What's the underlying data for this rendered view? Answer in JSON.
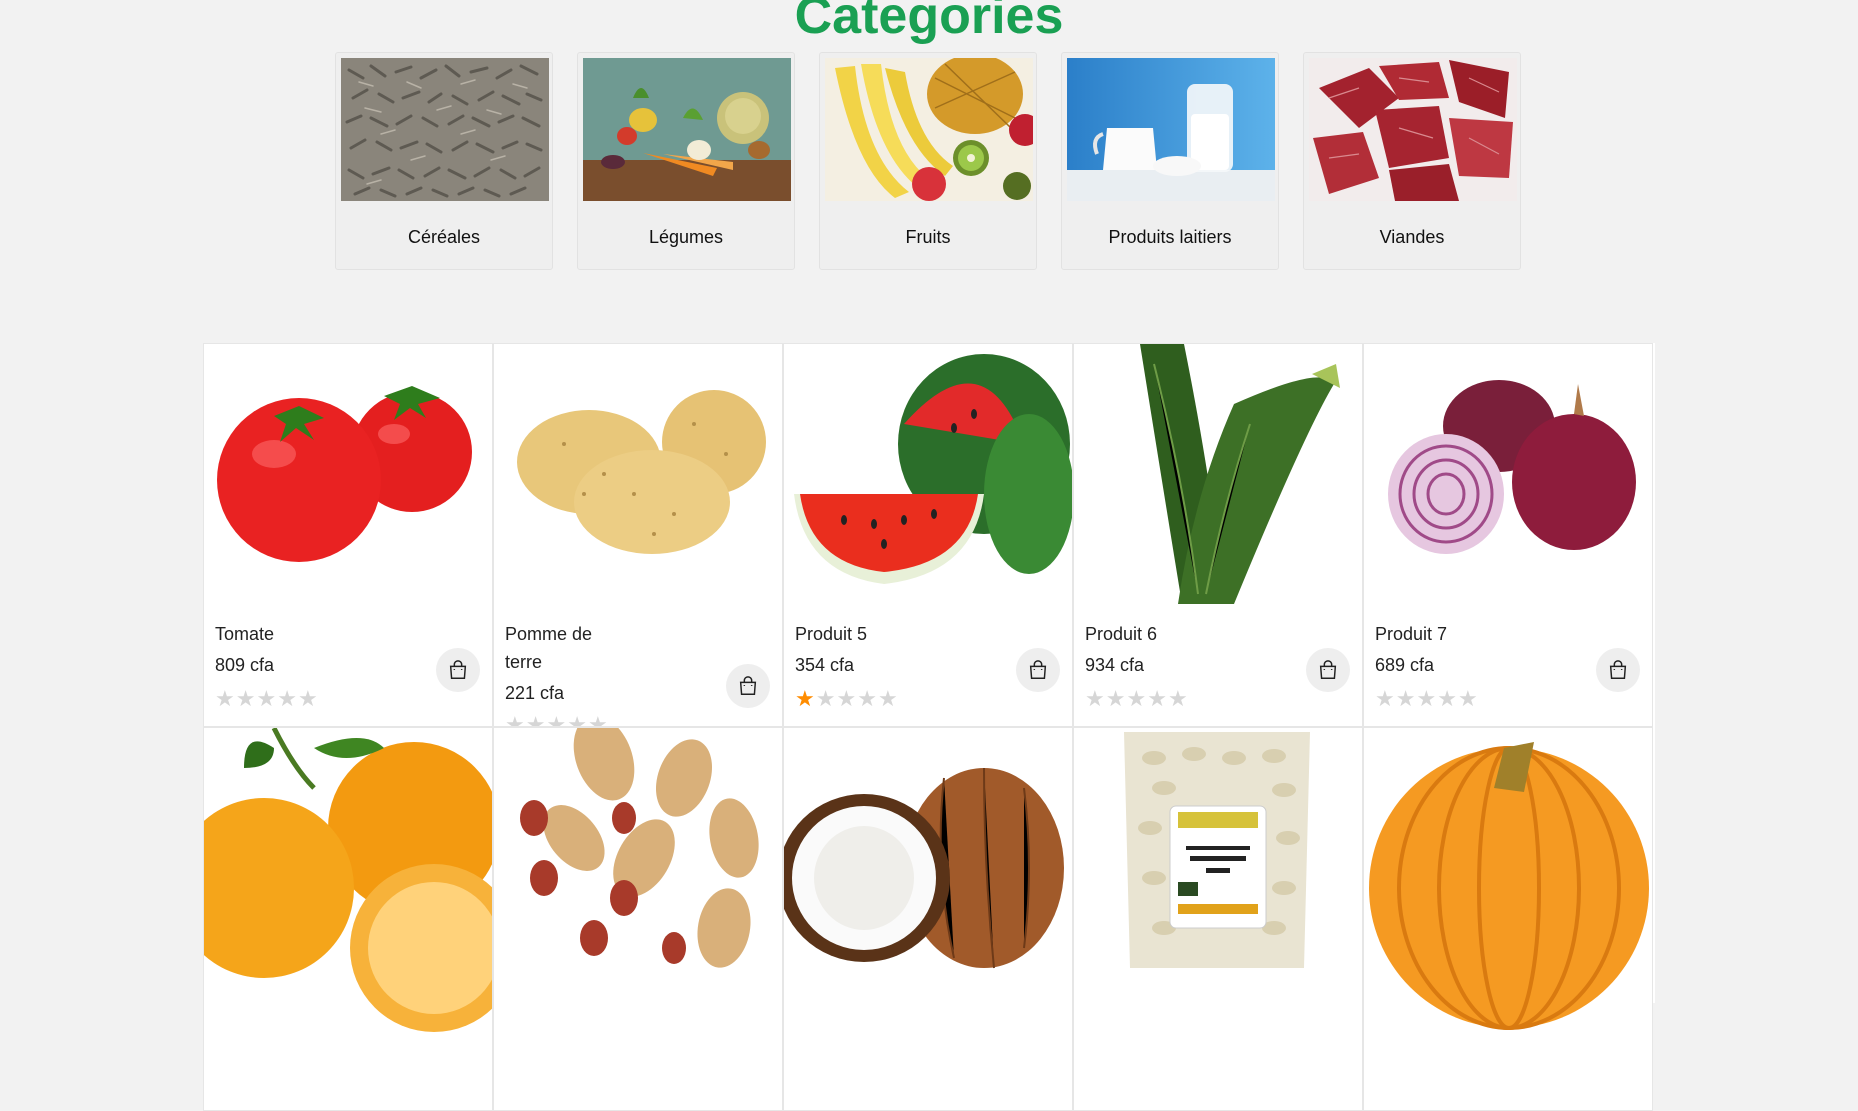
{
  "categories_section": {
    "title": "Categories",
    "items": [
      {
        "label": "Céréales"
      },
      {
        "label": "Légumes"
      },
      {
        "label": "Fruits"
      },
      {
        "label": "Produits laitiers"
      },
      {
        "label": "Viandes"
      }
    ]
  },
  "products": [
    {
      "name": "Tomate",
      "price": "809 cfa",
      "rating": 0
    },
    {
      "name": "Pomme de terre",
      "price": "221 cfa",
      "rating": 0
    },
    {
      "name": "Produit 5",
      "price": "354 cfa",
      "rating": 1
    },
    {
      "name": "Produit 6",
      "price": "934 cfa",
      "rating": 0
    },
    {
      "name": "Produit 7",
      "price": "689 cfa",
      "rating": 0
    }
  ],
  "colors": {
    "accent": "#1aa053",
    "star_on": "#ff8c00",
    "star_off": "#d6d6d6",
    "background": "#f2f2f2"
  },
  "icons": {
    "cart": "shopping-bag-icon",
    "star": "star-icon"
  }
}
